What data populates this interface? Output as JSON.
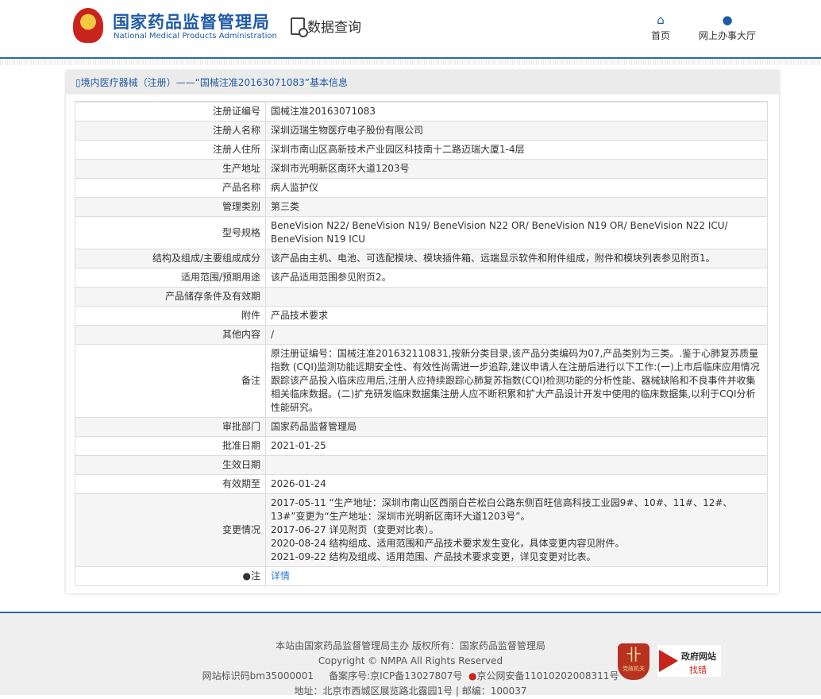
{
  "header": {
    "brand_cn": "国家药品监督管理局",
    "brand_en": "National Medical Products Administration",
    "query": "数据查询",
    "nav": [
      {
        "label": "首页",
        "icon": "home-icon"
      },
      {
        "label": "网上办事大厅",
        "icon": "user-icon"
      }
    ]
  },
  "panel": {
    "title": "境内医疗器械（注册）——“国械注准20163071083”基本信息"
  },
  "rows": [
    {
      "label": "注册证编号",
      "value": "国械注准20163071083"
    },
    {
      "label": "注册人名称",
      "value": "深圳迈瑞生物医疗电子股份有限公司"
    },
    {
      "label": "注册人住所",
      "value": "深圳市南山区高新技术产业园区科技南十二路迈瑞大厦1-4层"
    },
    {
      "label": "生产地址",
      "value": "深圳市光明新区南环大道1203号"
    },
    {
      "label": "产品名称",
      "value": "病人监护仪"
    },
    {
      "label": "管理类别",
      "value": "第三类"
    },
    {
      "label": "型号规格",
      "value": "BeneVision N22/ BeneVision N19/ BeneVision N22 OR/ BeneVision N19 OR/ BeneVision N22 ICU/ BeneVision N19 ICU"
    },
    {
      "label": "结构及组成/主要组成成分",
      "value": "该产品由主机、电池、可选配模块、模块插件箱、远端显示软件和附件组成，附件和模块列表参见附页1。"
    },
    {
      "label": "适用范围/预期用途",
      "value": "该产品适用范围参见附页2。"
    },
    {
      "label": "产品储存条件及有效期",
      "value": ""
    },
    {
      "label": "附件",
      "value": "产品技术要求"
    },
    {
      "label": "其他内容",
      "value": "/"
    },
    {
      "label": "备注",
      "value": "原注册证编号：国械注准201632110831,按新分类目录,该产品分类编码为07,产品类别为三类。.鉴于心肺复苏质量指数 (CQI)监测功能远期安全性、有效性尚需进一步追踪,建议申请人在注册后进行以下工作:(一)上市后临床应用情况跟踪该产品投入临床应用后,注册人应持续跟踪心肺复苏指数(CQI)检测功能的分析性能、器械缺陷和不良事件并收集相关临床数据。(二)扩充研发临床数据集注册人应不断积累和扩大产品设计开发中使用的临床数据集,以利于CQI分析性能研究。"
    },
    {
      "label": "审批部门",
      "value": "国家药品监督管理局"
    },
    {
      "label": "批准日期",
      "value": "2021-01-25"
    },
    {
      "label": "生效日期",
      "value": ""
    },
    {
      "label": "有效期至",
      "value": "2026-01-24"
    }
  ],
  "changes": {
    "label": "变更情况",
    "items": [
      "2017-05-11 “生产地址：深圳市南山区西丽白芒松白公路东侧百旺信高科技工业园9#、10#、11#、12#、13#”变更为“生产地址：深圳市光明新区南环大道1203号”。",
      "2017-06-27 详见附页（变更对比表）。",
      "2020-08-24 结构组成、适用范围和产品技术要求发生变化，具体变更内容见附件。",
      "2021-09-22 结构及组成、适用范围、产品技术要求变更，详见变更对比表。"
    ]
  },
  "note": {
    "label": "注",
    "link": "详情"
  },
  "footer": {
    "line1": "本站由国家药品监督管理局主办 版权所有：国家药品监督管理局",
    "line2": "Copyright © NMPA All Rights Reserved",
    "site_id": "网站标识码bm35000001",
    "icp": "备案序号:京ICP备13027807号",
    "police": "京公网安备11010202008311号",
    "address": "地址：北京市西城区展览路北露园1号 | 邮编：100037",
    "badge1": "党政机关",
    "badge2_title": "政府网站",
    "badge2_sub": "找错"
  }
}
